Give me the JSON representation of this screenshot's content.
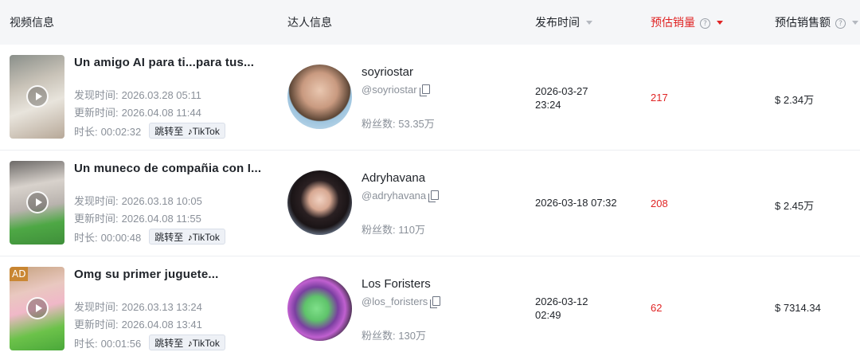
{
  "headers": {
    "video_info": "视频信息",
    "creator_info": "达人信息",
    "publish_time": "发布时间",
    "est_sales": "预估销量",
    "est_gmv": "预估销售额"
  },
  "labels": {
    "discovered": "发现时间:",
    "updated": "更新时间:",
    "duration": "时长:",
    "goto_tiktok": "跳转至",
    "tiktok": "TikTok",
    "fans": "粉丝数:",
    "help_glyph": "?"
  },
  "rows": [
    {
      "title": "Un amigo AI para ti...para tus...",
      "discovered": "2026.03.28 05:11",
      "updated": "2026.04.08 11:44",
      "duration": "00:02:32",
      "creator_name": "soyriostar",
      "creator_handle": "@soyriostar",
      "fans": "53.35万",
      "publish_line1": "2026-03-27",
      "publish_line2": "23:24",
      "sales": "217",
      "gmv": "$ 2.34万"
    },
    {
      "title": "Un muneco de compañia con I...",
      "discovered": "2026.03.18 10:05",
      "updated": "2026.04.08 11:55",
      "duration": "00:00:48",
      "creator_name": "Adryhavana",
      "creator_handle": "@adryhavana",
      "fans": "110万",
      "publish_line1": "2026-03-18 07:32",
      "publish_line2": "",
      "sales": "208",
      "gmv": "$ 2.45万"
    },
    {
      "title": "Omg su primer juguete...",
      "ad_badge": "AD",
      "discovered": "2026.03.13 13:24",
      "updated": "2026.04.08 13:41",
      "duration": "00:01:56",
      "creator_name": "Los Foristers",
      "creator_handle": "@los_foristers",
      "fans": "130万",
      "publish_line1": "2026-03-12",
      "publish_line2": "02:49",
      "sales": "62",
      "gmv": "$ 7314.34"
    }
  ],
  "colors": {
    "accent_red": "#e02424",
    "header_bg": "#f5f6f8",
    "muted_text": "#8a9099"
  },
  "icons": [
    "play-icon",
    "copy-icon",
    "help-icon",
    "sort-caret-icon",
    "tiktok-logo-icon"
  ]
}
